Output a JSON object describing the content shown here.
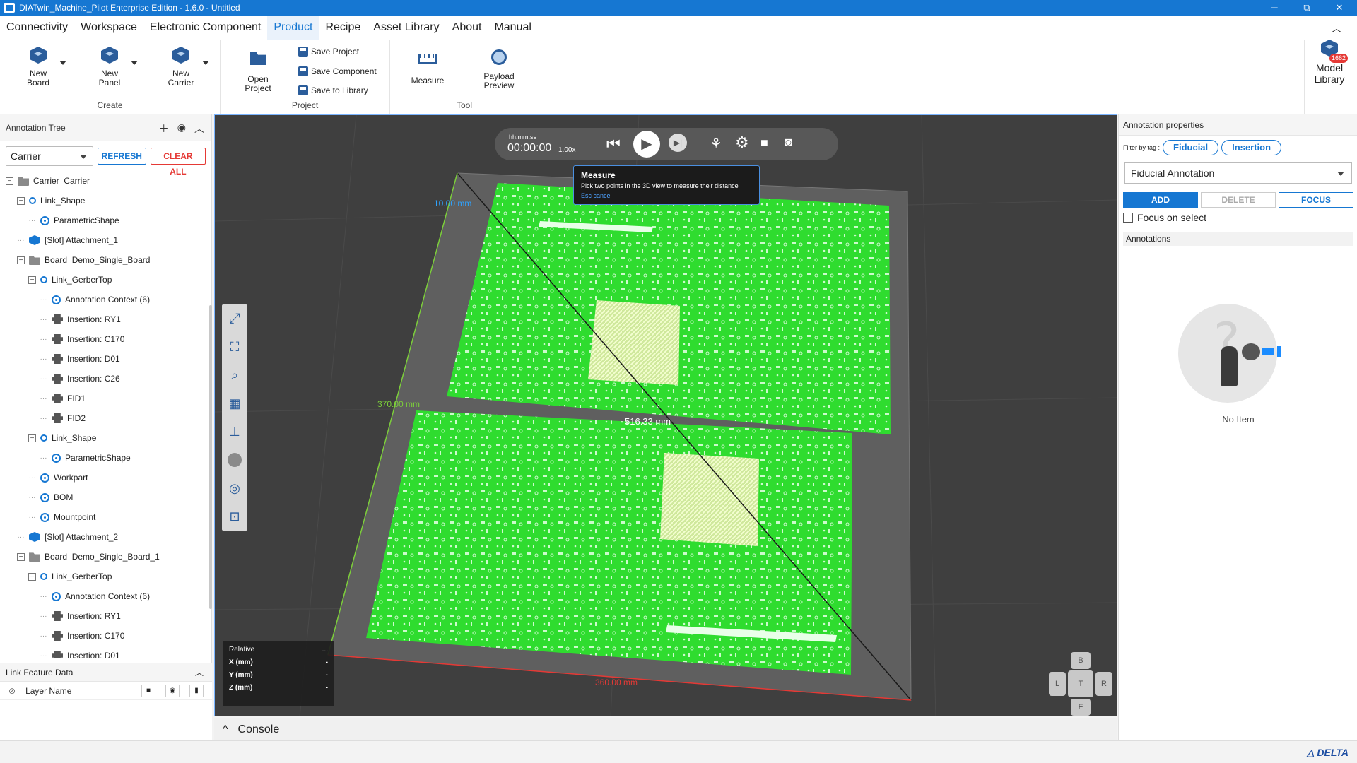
{
  "window": {
    "title": "DIATwin_Machine_Pilot Enterprise Edition - 1.6.0 - Untitled",
    "minimize": "─",
    "restore": "⧉",
    "close": "✕"
  },
  "menu": {
    "items": [
      "Connectivity",
      "Workspace",
      "Electronic Component",
      "Product",
      "Recipe",
      "Asset Library",
      "About",
      "Manual"
    ],
    "active": "Product"
  },
  "ribbon": {
    "create": {
      "label": "Create",
      "new_board": "New\nBoard",
      "new_panel": "New\nPanel",
      "new_carrier": "New\nCarrier"
    },
    "project": {
      "label": "Project",
      "open_project": "Open\nProject",
      "save_project": "Save Project",
      "save_component": "Save Component",
      "save_to_library": "Save to Library"
    },
    "tool": {
      "label": "Tool",
      "measure": "Measure",
      "payload_preview": "Payload\nPreview"
    },
    "model_library": {
      "label": "Model\nLibrary",
      "badge": "1662"
    }
  },
  "annotation_tree": {
    "title": "Annotation Tree",
    "filter_value": "Carrier",
    "refresh": "REFRESH",
    "clear_all": "CLEAR ALL",
    "rows": [
      {
        "level": 0,
        "type": "folder",
        "exp": "−",
        "label": "Carrier  Carrier"
      },
      {
        "level": 1,
        "type": "link",
        "exp": "−",
        "label": "Link_Shape"
      },
      {
        "level": 2,
        "type": "anno",
        "exp": "",
        "label": "ParametricShape"
      },
      {
        "level": 1,
        "type": "slot",
        "exp": "",
        "label": "[Slot] Attachment_1"
      },
      {
        "level": 1,
        "type": "folder",
        "exp": "−",
        "label": "Board  Demo_Single_Board"
      },
      {
        "level": 2,
        "type": "link",
        "exp": "−",
        "label": "Link_GerberTop"
      },
      {
        "level": 3,
        "type": "anno",
        "exp": "",
        "label": "Annotation Context (6)"
      },
      {
        "level": 3,
        "type": "ins",
        "exp": "",
        "label": "Insertion: RY1"
      },
      {
        "level": 3,
        "type": "ins",
        "exp": "",
        "label": "Insertion: C170"
      },
      {
        "level": 3,
        "type": "ins",
        "exp": "",
        "label": "Insertion: D01"
      },
      {
        "level": 3,
        "type": "ins",
        "exp": "",
        "label": "Insertion: C26"
      },
      {
        "level": 3,
        "type": "ins",
        "exp": "",
        "label": "FID1"
      },
      {
        "level": 3,
        "type": "ins",
        "exp": "",
        "label": "FID2"
      },
      {
        "level": 2,
        "type": "link",
        "exp": "−",
        "label": "Link_Shape"
      },
      {
        "level": 3,
        "type": "anno",
        "exp": "",
        "label": "ParametricShape"
      },
      {
        "level": 2,
        "type": "anno",
        "exp": "",
        "label": "Workpart"
      },
      {
        "level": 2,
        "type": "anno",
        "exp": "",
        "label": "BOM"
      },
      {
        "level": 2,
        "type": "anno",
        "exp": "",
        "label": "Mountpoint"
      },
      {
        "level": 1,
        "type": "slot",
        "exp": "",
        "label": "[Slot] Attachment_2"
      },
      {
        "level": 1,
        "type": "folder",
        "exp": "−",
        "label": "Board  Demo_Single_Board_1"
      },
      {
        "level": 2,
        "type": "link",
        "exp": "−",
        "label": "Link_GerberTop"
      },
      {
        "level": 3,
        "type": "anno",
        "exp": "",
        "label": "Annotation Context (6)"
      },
      {
        "level": 3,
        "type": "ins",
        "exp": "",
        "label": "Insertion: RY1"
      },
      {
        "level": 3,
        "type": "ins",
        "exp": "",
        "label": "Insertion: C170"
      },
      {
        "level": 3,
        "type": "ins",
        "exp": "",
        "label": "Insertion: D01"
      }
    ]
  },
  "link_feature": {
    "title": "Link Feature Data",
    "layer_name": "Layer Name"
  },
  "viewport": {
    "time_format": "hh:mm:ss",
    "time": "00:00:00",
    "speed": "1.00x",
    "tooltip_title": "Measure",
    "tooltip_text": "Pick two points in the 3D view to measure their distance",
    "tooltip_cancel": "Esc cancel",
    "dim_blue": "10.00 mm",
    "dim_green": "370.00 mm",
    "dim_diag": "516.33 mm",
    "dim_red": "360.00 mm",
    "coords": {
      "title": "Relative",
      "more": "...",
      "x_label": "X (mm)",
      "y_label": "Y (mm)",
      "z_label": "Z (mm)",
      "x": "-",
      "y": "-",
      "z": "-"
    },
    "navcube": {
      "b": "B",
      "l": "L",
      "t": "T",
      "r": "R",
      "f": "F"
    }
  },
  "console": {
    "label": "Console",
    "toggle": "^"
  },
  "annotation_properties": {
    "title": "Annotation properties",
    "filter_label": "Filter by tag :",
    "tag_fiducial": "Fiducial",
    "tag_insertion": "Insertion",
    "type_value": "Fiducial Annotation",
    "add": "ADD",
    "delete": "DELETE",
    "focus": "FOCUS",
    "focus_on_select": "Focus on select",
    "annotations_header": "Annotations",
    "empty": "No Item"
  },
  "status": {
    "brand": "DELTA"
  },
  "colors": {
    "accent": "#1677d2",
    "pcb": "#2fdc2f",
    "viewport": "#3f3f3f",
    "danger": "#e53935"
  }
}
